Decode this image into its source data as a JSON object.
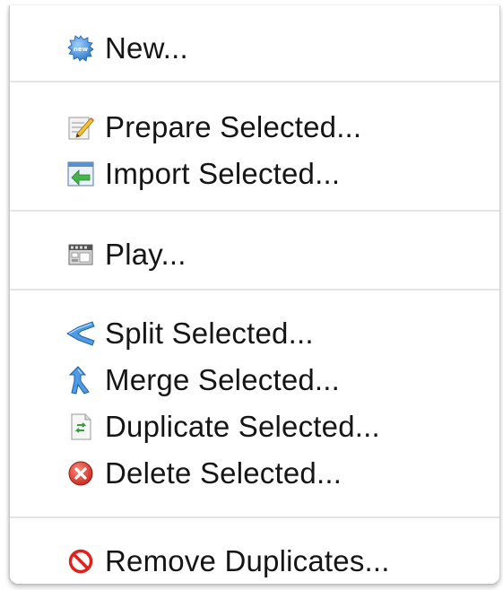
{
  "menu": {
    "items": [
      {
        "label": "New...",
        "icon": "new-badge-icon"
      },
      {
        "label": "Prepare Selected...",
        "icon": "prepare-edit-icon"
      },
      {
        "label": "Import Selected...",
        "icon": "import-arrow-icon"
      },
      {
        "label": "Play...",
        "icon": "play-film-icon"
      },
      {
        "label": "Split Selected...",
        "icon": "split-arrow-icon"
      },
      {
        "label": "Merge Selected...",
        "icon": "merge-arrow-icon"
      },
      {
        "label": "Duplicate Selected...",
        "icon": "duplicate-document-icon"
      },
      {
        "label": "Delete Selected...",
        "icon": "delete-x-icon"
      },
      {
        "label": "Remove Duplicates...",
        "icon": "prohibited-icon"
      }
    ]
  },
  "colors": {
    "separator": "#e4e4e4",
    "text": "#151515",
    "delete_red": "#d9392b",
    "prohibited_red": "#e0201b",
    "accent_blue": "#2f7fd8"
  }
}
